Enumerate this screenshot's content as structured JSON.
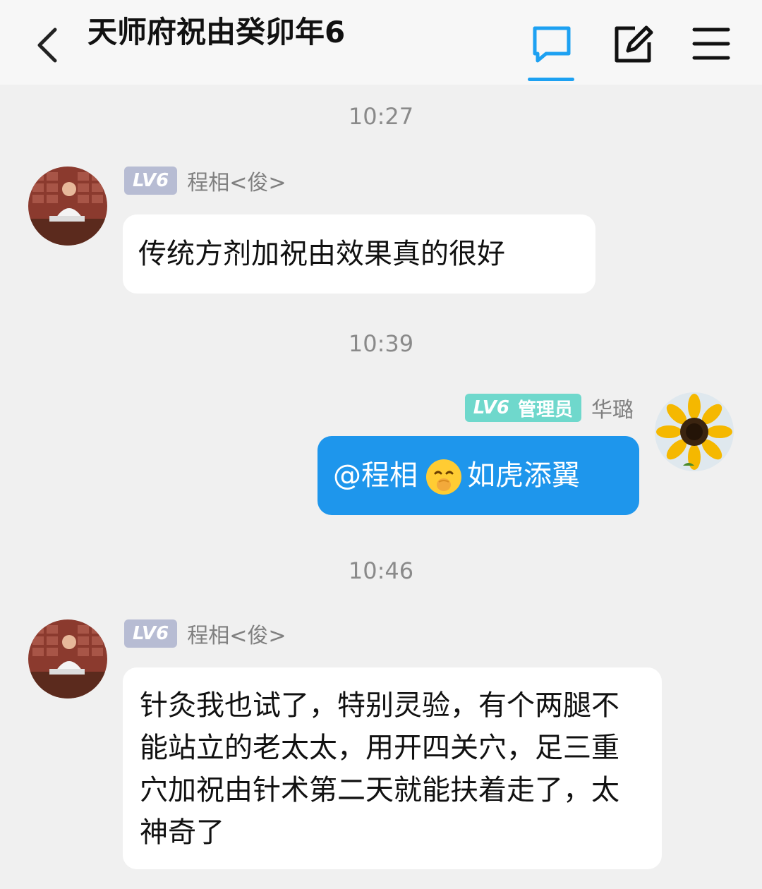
{
  "header": {
    "title": "天师府祝由癸卯年6",
    "icons": [
      "back-icon",
      "chat-icon",
      "edit-icon",
      "menu-icon"
    ],
    "accent_color": "#1da1f2"
  },
  "messages": [
    {
      "time": "10:27",
      "side": "left",
      "badge": "LV6",
      "sender": "程相<俊>",
      "text": "传统方剂加祝由效果真的很好"
    },
    {
      "time": "10:39",
      "side": "right",
      "badge": "LV6",
      "role": "管理员",
      "sender": "华璐",
      "mention": "@程相",
      "emoji": "smirk-face-emoji",
      "text": "如虎添翼"
    },
    {
      "time": "10:46",
      "side": "left",
      "badge": "LV6",
      "sender": "程相<俊>",
      "text": "针灸我也试了，特别灵验，有个两腿不能站立的老太太，用开四关穴，足三重穴加祝由针术第二天就能扶着走了，太神奇了"
    }
  ],
  "colors": {
    "self_bubble": "#1e96ec",
    "other_bubble": "#ffffff",
    "lv_badge": "#b7bcd3",
    "admin_badge": "#6fd8cc",
    "background": "#f0f0f0"
  }
}
